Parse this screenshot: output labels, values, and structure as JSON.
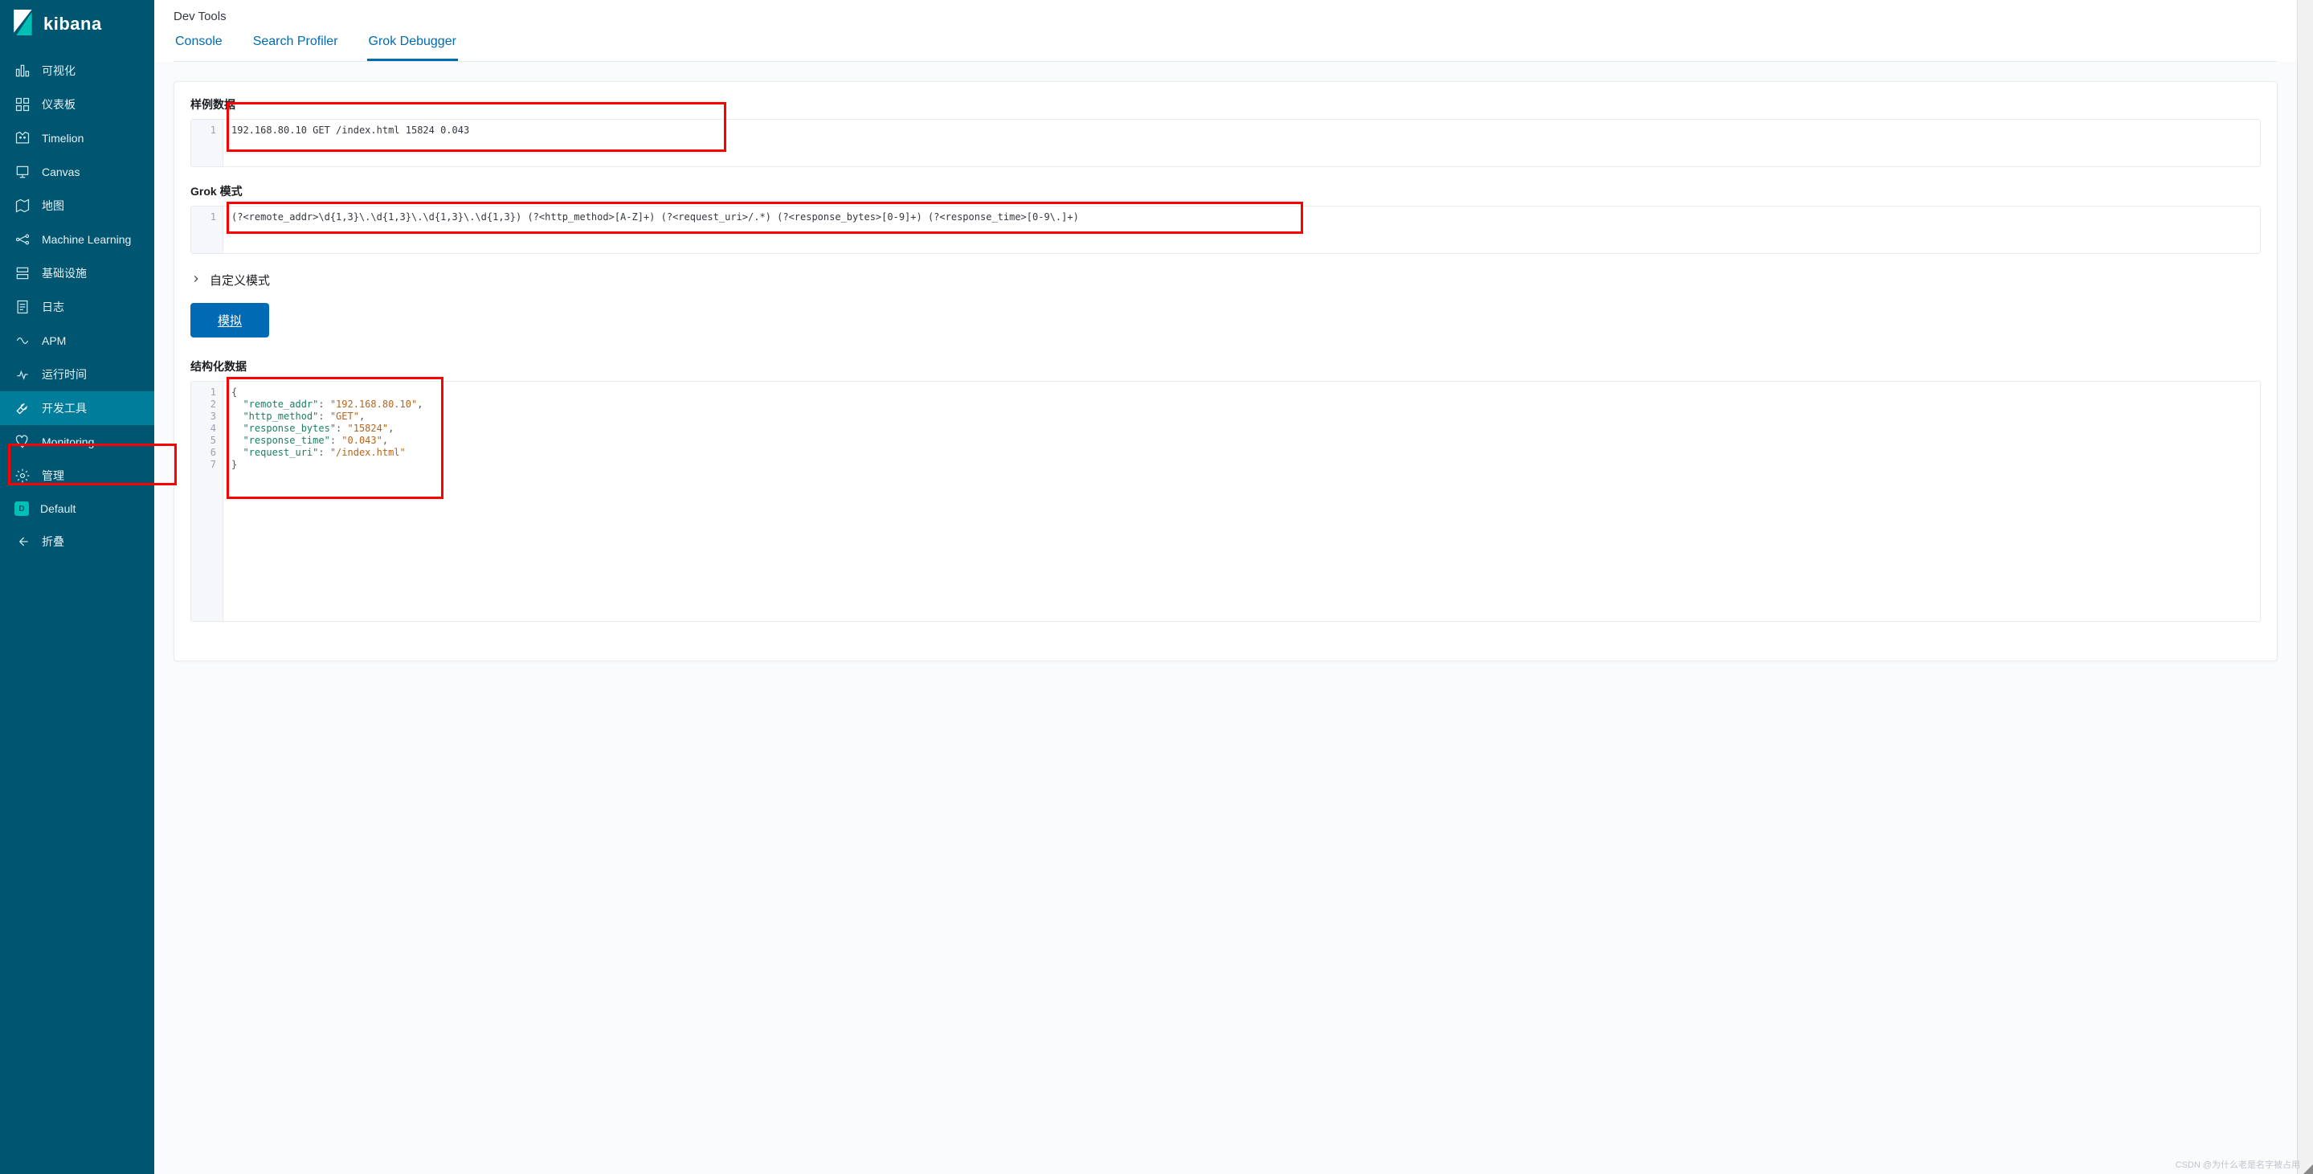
{
  "app": {
    "name": "kibana"
  },
  "sidebar": {
    "items": [
      {
        "label": "可视化",
        "name": "visualize"
      },
      {
        "label": "仪表板",
        "name": "dashboard"
      },
      {
        "label": "Timelion",
        "name": "timelion"
      },
      {
        "label": "Canvas",
        "name": "canvas"
      },
      {
        "label": "地图",
        "name": "maps"
      },
      {
        "label": "Machine Learning",
        "name": "ml"
      },
      {
        "label": "基础设施",
        "name": "infrastructure"
      },
      {
        "label": "日志",
        "name": "logs"
      },
      {
        "label": "APM",
        "name": "apm"
      },
      {
        "label": "运行时间",
        "name": "uptime"
      },
      {
        "label": "开发工具",
        "name": "dev-tools",
        "active": true
      },
      {
        "label": "Monitoring",
        "name": "monitoring"
      },
      {
        "label": "管理",
        "name": "management"
      },
      {
        "label": "Default",
        "name": "default",
        "badge": "D"
      },
      {
        "label": "折叠",
        "name": "collapse"
      }
    ]
  },
  "header": {
    "title": "Dev Tools"
  },
  "tabs": [
    {
      "label": "Console",
      "active": false
    },
    {
      "label": "Search Profiler",
      "active": false
    },
    {
      "label": "Grok Debugger",
      "active": true
    }
  ],
  "sample": {
    "label": "样例数据",
    "line_no": "1",
    "text": "192.168.80.10 GET /index.html 15824 0.043"
  },
  "grok": {
    "label": "Grok 模式",
    "line_no": "1",
    "text": "(?<remote_addr>\\d{1,3}\\.\\d{1,3}\\.\\d{1,3}\\.\\d{1,3}) (?<http_method>[A-Z]+) (?<request_uri>/.*) (?<response_bytes>[0-9]+) (?<response_time>[0-9\\.]+)"
  },
  "custom_patterns": {
    "label": "自定义模式"
  },
  "simulate": {
    "label": "模拟"
  },
  "output": {
    "label": "结构化数据",
    "lines": [
      "1",
      "2",
      "3",
      "4",
      "5",
      "6",
      "7"
    ],
    "json": {
      "remote_addr": "192.168.80.10",
      "http_method": "GET",
      "response_bytes": "15824",
      "response_time": "0.043",
      "request_uri": "/index.html"
    }
  },
  "watermark": "CSDN @为什么老是名字被占用"
}
